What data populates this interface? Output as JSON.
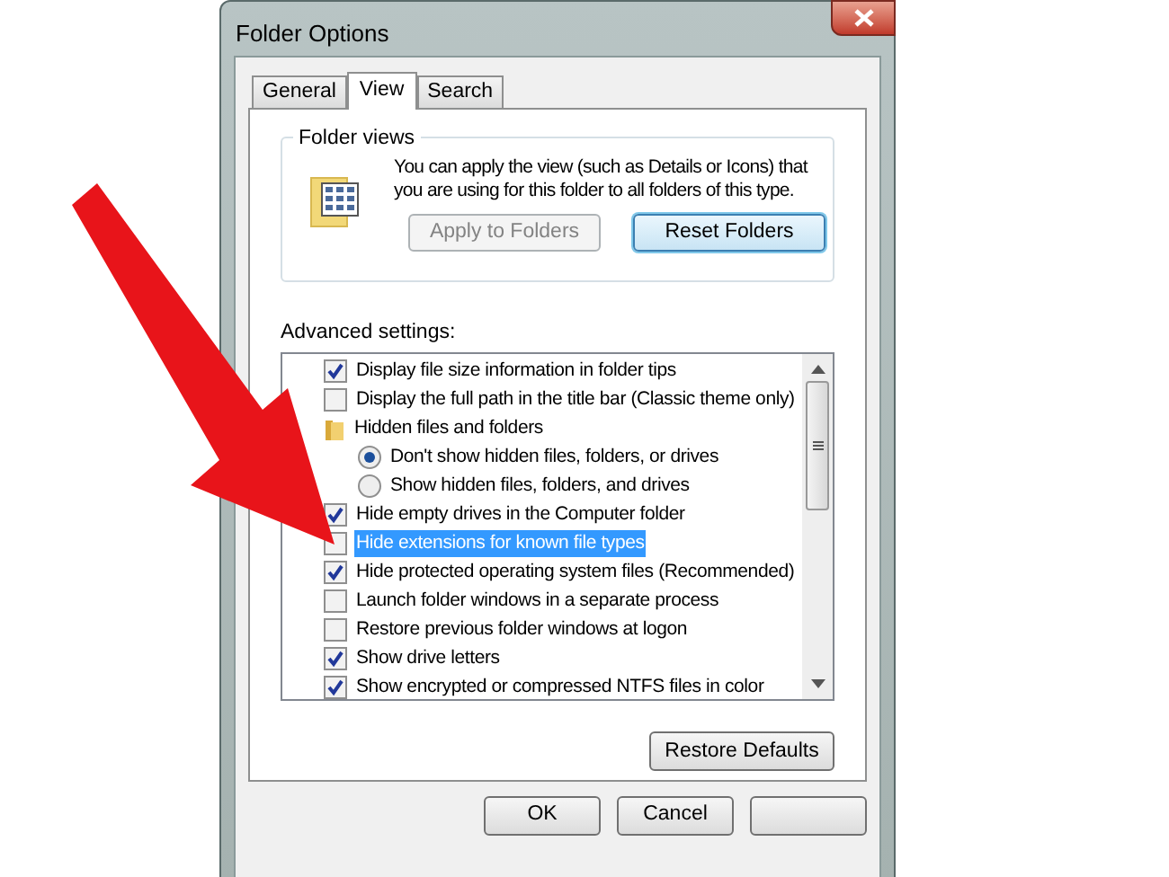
{
  "window": {
    "title": "Folder Options"
  },
  "tabs": [
    {
      "label": "General",
      "selected": false
    },
    {
      "label": "View",
      "selected": true
    },
    {
      "label": "Search",
      "selected": false
    }
  ],
  "folder_views": {
    "title": "Folder views",
    "description": "You can apply the view (such as Details or Icons) that you are using for this folder to all folders of this type.",
    "buttons": [
      {
        "label": "Apply to Folders",
        "disabled": true,
        "focused": false
      },
      {
        "label": "Reset Folders",
        "disabled": false,
        "focused": true
      }
    ]
  },
  "advanced_settings": {
    "label": "Advanced settings:",
    "items": [
      {
        "kind": "checkbox",
        "label": "Display file size information in folder tips",
        "checked": true,
        "selected": false
      },
      {
        "kind": "checkbox",
        "label": "Display the full path in the title bar (Classic theme only)",
        "checked": false,
        "selected": false
      },
      {
        "kind": "folder",
        "label": "Hidden files and folders",
        "selected": false
      },
      {
        "kind": "radio",
        "label": "Don't show hidden files, folders, or drives",
        "checked": true,
        "selected": false
      },
      {
        "kind": "radio",
        "label": "Show hidden files, folders, and drives",
        "checked": false,
        "selected": false
      },
      {
        "kind": "checkbox",
        "label": "Hide empty drives in the Computer folder",
        "checked": true,
        "selected": false
      },
      {
        "kind": "checkbox",
        "label": "Hide extensions for known file types",
        "checked": false,
        "selected": true
      },
      {
        "kind": "checkbox",
        "label": "Hide protected operating system files (Recommended)",
        "checked": true,
        "selected": false
      },
      {
        "kind": "checkbox",
        "label": "Launch folder windows in a separate process",
        "checked": false,
        "selected": false
      },
      {
        "kind": "checkbox",
        "label": "Restore previous folder windows at logon",
        "checked": false,
        "selected": false
      },
      {
        "kind": "checkbox",
        "label": "Show drive letters",
        "checked": true,
        "selected": false
      },
      {
        "kind": "checkbox",
        "label": "Show encrypted or compressed NTFS files in color",
        "checked": true,
        "selected": false
      }
    ]
  },
  "restore_button": "Restore Defaults",
  "dialog_buttons": [
    {
      "kind": "labeled",
      "label": "OK"
    },
    {
      "kind": "labeled",
      "label": "Cancel"
    },
    {
      "kind": "blank"
    }
  ]
}
